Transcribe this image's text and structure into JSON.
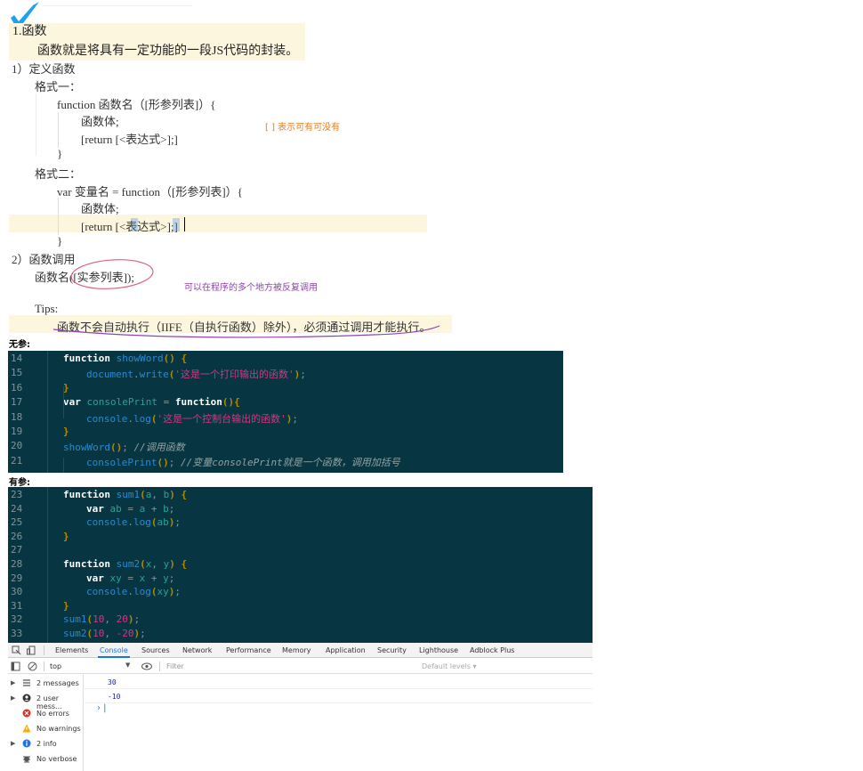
{
  "doc": {
    "heading": "1.函数",
    "intro": "函数就是将具有一定功能的一段JS代码的封装。",
    "sec1": "1）定义函数",
    "fmt1_label": "格式一：",
    "fmt1_line1": "function 函数名（[形参列表]）{",
    "fmt1_line2": "函数体;",
    "fmt1_line3": "[return [<表达式>];]",
    "fmt1_close": "}",
    "fmt2_label": "格式二：",
    "fmt2_line1": "var 变量名 = function（[形参列表]）{",
    "fmt2_line2": "函数体;",
    "fmt2_line3": "[return [<表达式>];]",
    "fmt2_close": "}",
    "sec2": "2）函数调用",
    "call": "函数名([实参列表]);",
    "tips_label": "Tips:",
    "tips": "函数不会自动执行（IIFE（自执行函数）除外），必须通过调用才能执行。",
    "note_optional": "[ ] 表示可有可没有",
    "note_call": "可以在程序的多个地方被反复调用",
    "no_param_label": "无参:",
    "with_param_label": "有参:"
  },
  "code1": [
    {
      "n": "14",
      "t": "function showWord() {"
    },
    {
      "n": "15",
      "t": "document.write('这是一个打印输出的函数');"
    },
    {
      "n": "16",
      "t": "}"
    },
    {
      "n": "17",
      "t": "var consolePrint = function(){"
    },
    {
      "n": "18",
      "t": "console.log('这是一个控制台输出的函数');"
    },
    {
      "n": "19",
      "t": "}"
    },
    {
      "n": "20",
      "t": "showWord(); //调用函数"
    },
    {
      "n": "21",
      "t": "consolePrint(); //变量consolePrint就是一个函数，调用加括号"
    }
  ],
  "code2": [
    {
      "n": "23",
      "t": "function sum1(a, b) {"
    },
    {
      "n": "24",
      "t": "var ab = a + b;"
    },
    {
      "n": "25",
      "t": "console.log(ab);"
    },
    {
      "n": "26",
      "t": "}"
    },
    {
      "n": "27",
      "t": ""
    },
    {
      "n": "28",
      "t": "function sum2(x, y) {"
    },
    {
      "n": "29",
      "t": "var xy = x + y;"
    },
    {
      "n": "30",
      "t": "console.log(xy);"
    },
    {
      "n": "31",
      "t": "}"
    },
    {
      "n": "32",
      "t": "sum1(10, 20);"
    },
    {
      "n": "33",
      "t": "sum2(10, -20);"
    }
  ],
  "devtools": {
    "tabs": [
      "Elements",
      "Console",
      "Sources",
      "Network",
      "Performance",
      "Memory",
      "Application",
      "Security",
      "Lighthouse",
      "Adblock Plus"
    ],
    "active_tab": "Console",
    "context": "top",
    "filter_placeholder": "Filter",
    "levels": "Default levels ▾",
    "sidebar": [
      {
        "icon": "list-icon",
        "label": "2 messages"
      },
      {
        "icon": "user-icon",
        "label": "2 user mess..."
      },
      {
        "icon": "error-icon",
        "label": "No errors"
      },
      {
        "icon": "warning-icon",
        "label": "No warnings"
      },
      {
        "icon": "info-icon",
        "label": "2 info"
      },
      {
        "icon": "verbose-icon",
        "label": "No verbose"
      }
    ],
    "output": [
      "30",
      "-10"
    ],
    "prompt": "›",
    "colors": {
      "accent": "#1a73e8",
      "error": "#d93025",
      "warning": "#f9ab00",
      "code_bg": "#073642"
    }
  }
}
